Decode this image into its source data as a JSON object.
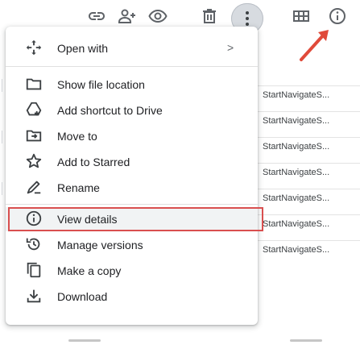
{
  "toolbar": {
    "icons": [
      "link-icon",
      "share-icon",
      "eye-icon",
      "trash-icon",
      "more-vert-icon",
      "grid-icon",
      "info-icon"
    ]
  },
  "menu": {
    "items": [
      {
        "label": "Open with",
        "icon": "open-with-icon",
        "has_submenu": true,
        "chevron": ">"
      },
      {
        "label": "Show file location",
        "icon": "folder-icon"
      },
      {
        "label": "Add shortcut to Drive",
        "icon": "add-shortcut-icon"
      },
      {
        "label": "Move to",
        "icon": "move-to-icon"
      },
      {
        "label": "Add to Starred",
        "icon": "star-icon"
      },
      {
        "label": "Rename",
        "icon": "rename-icon"
      },
      {
        "label": "View details",
        "icon": "info-icon",
        "highlighted": true
      },
      {
        "label": "Manage versions",
        "icon": "history-icon"
      },
      {
        "label": "Make a copy",
        "icon": "copy-icon"
      },
      {
        "label": "Download",
        "icon": "download-icon"
      }
    ]
  },
  "file_list": {
    "rows": [
      "StartNavigateS...",
      "StartNavigateS...",
      "StartNavigateS...",
      "StartNavigateS...",
      "StartNavigateS...",
      "StartNavigateS...",
      "StartNavigateS..."
    ]
  },
  "colors": {
    "highlight_border": "#d94f4f",
    "arrow": "#e04a3a",
    "more_button_bg": "#d7dbe0"
  }
}
